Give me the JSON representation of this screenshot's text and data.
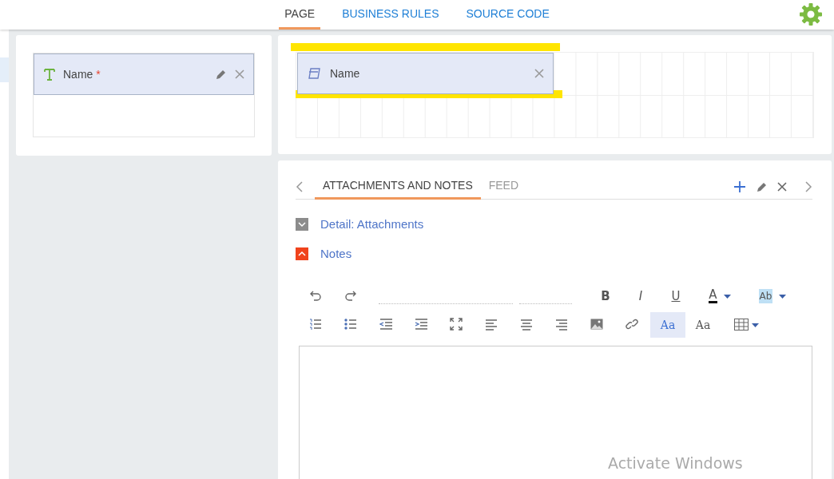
{
  "top_tabs": [
    {
      "label": "PAGE",
      "selected": true
    },
    {
      "label": "BUSINESS RULES",
      "selected": false
    },
    {
      "label": "SOURCE CODE",
      "selected": false
    }
  ],
  "left_panel": {
    "field": {
      "label": "Name",
      "required_mark": "*"
    }
  },
  "right_panel": {
    "field": {
      "label": "Name"
    }
  },
  "detail_tabs": [
    {
      "label": "ATTACHMENTS AND NOTES",
      "selected": true
    },
    {
      "label": "FEED",
      "selected": false
    }
  ],
  "groups": [
    {
      "label": "Detail: Attachments",
      "expanded": false
    },
    {
      "label": "Notes",
      "expanded": true
    }
  ],
  "toolbar_rows": [
    [
      {
        "kind": "undo"
      },
      {
        "kind": "redo"
      },
      {
        "kind": "fontselect"
      },
      {
        "kind": "sizeselect"
      },
      {
        "kind": "bold",
        "label": "B"
      },
      {
        "kind": "italic",
        "label": "I"
      },
      {
        "kind": "underline",
        "label": "U"
      },
      {
        "kind": "fontcolor",
        "label": "A"
      },
      {
        "kind": "highlight",
        "label": "Ab"
      }
    ],
    [
      {
        "kind": "olist"
      },
      {
        "kind": "ulist"
      },
      {
        "kind": "outdent"
      },
      {
        "kind": "indent"
      },
      {
        "kind": "fullscreen"
      },
      {
        "kind": "alignleft"
      },
      {
        "kind": "aligncenter"
      },
      {
        "kind": "alignright"
      },
      {
        "kind": "image"
      },
      {
        "kind": "link"
      },
      {
        "kind": "mode",
        "label": "Aa",
        "selected": true
      },
      {
        "kind": "mode",
        "label": "Aa",
        "selected": false
      },
      {
        "kind": "table"
      }
    ]
  ],
  "os_notice": {
    "text": "Activate Windows"
  }
}
